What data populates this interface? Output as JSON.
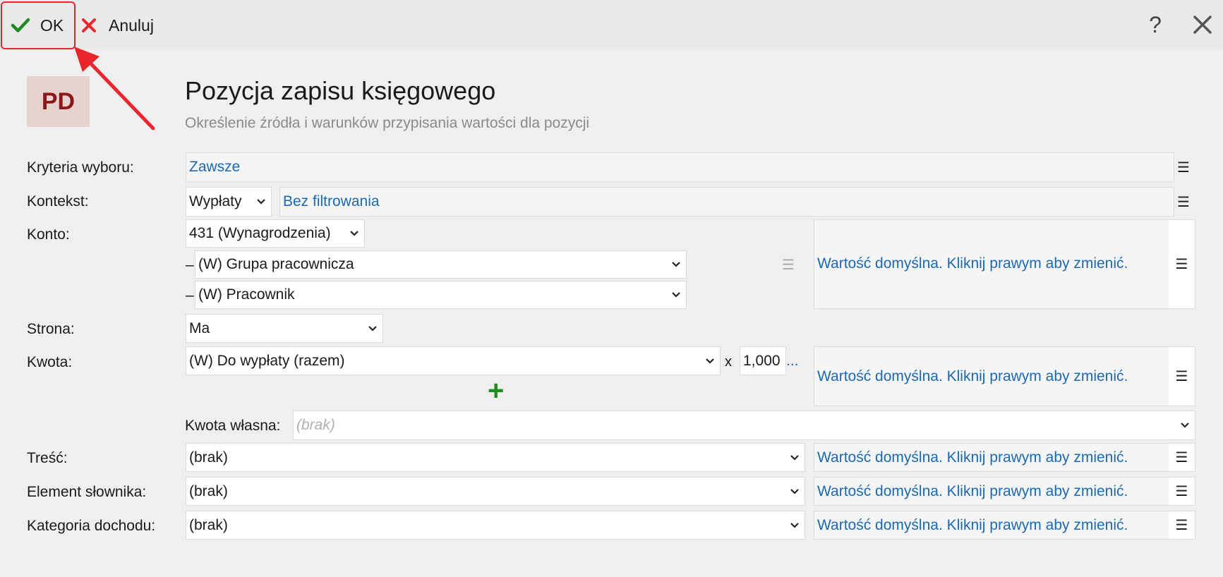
{
  "toolbar": {
    "ok_label": "OK",
    "cancel_label": "Anuluj",
    "help_label": "?"
  },
  "header": {
    "logo": "PD",
    "title": "Pozycja zapisu księgowego",
    "subtitle": "Określenie źródła i warunków przypisania wartości dla pozycji"
  },
  "menu_glyph": "☰",
  "default_value_text": "Wartość domyślna. Kliknij prawym aby zmienić.",
  "fields": {
    "kryteria": {
      "label": "Kryteria wyboru:",
      "value": "Zawsze"
    },
    "kontekst": {
      "label": "Kontekst:",
      "select": "Wypłaty",
      "filter": "Bez filtrowania"
    },
    "konto": {
      "label": "Konto:",
      "account": "431 (Wynagrodzenia)",
      "sub1": "(W) Grupa pracownicza",
      "sub2": "(W) Pracownik",
      "dash": "–"
    },
    "strona": {
      "label": "Strona:",
      "value": "Ma"
    },
    "kwota": {
      "label": "Kwota:",
      "value": "(W) Do wypłaty (razem)",
      "times": "x",
      "multiplier": "1,000",
      "ellipsis": "...",
      "plus": "+"
    },
    "kwota_wlasna": {
      "label": "Kwota własna:",
      "placeholder": "(brak)"
    },
    "tresc": {
      "label": "Treść:",
      "value": "(brak)"
    },
    "element": {
      "label": "Element słownika:",
      "value": "(brak)"
    },
    "kategoria": {
      "label": "Kategoria dochodu:",
      "value": "(brak)"
    }
  },
  "colors": {
    "accent_red": "#e8262c",
    "link_blue": "#1c69b3",
    "ok_green": "#1f8a1f",
    "logo_bg": "#e6d2cf",
    "logo_fg": "#8e1616"
  }
}
